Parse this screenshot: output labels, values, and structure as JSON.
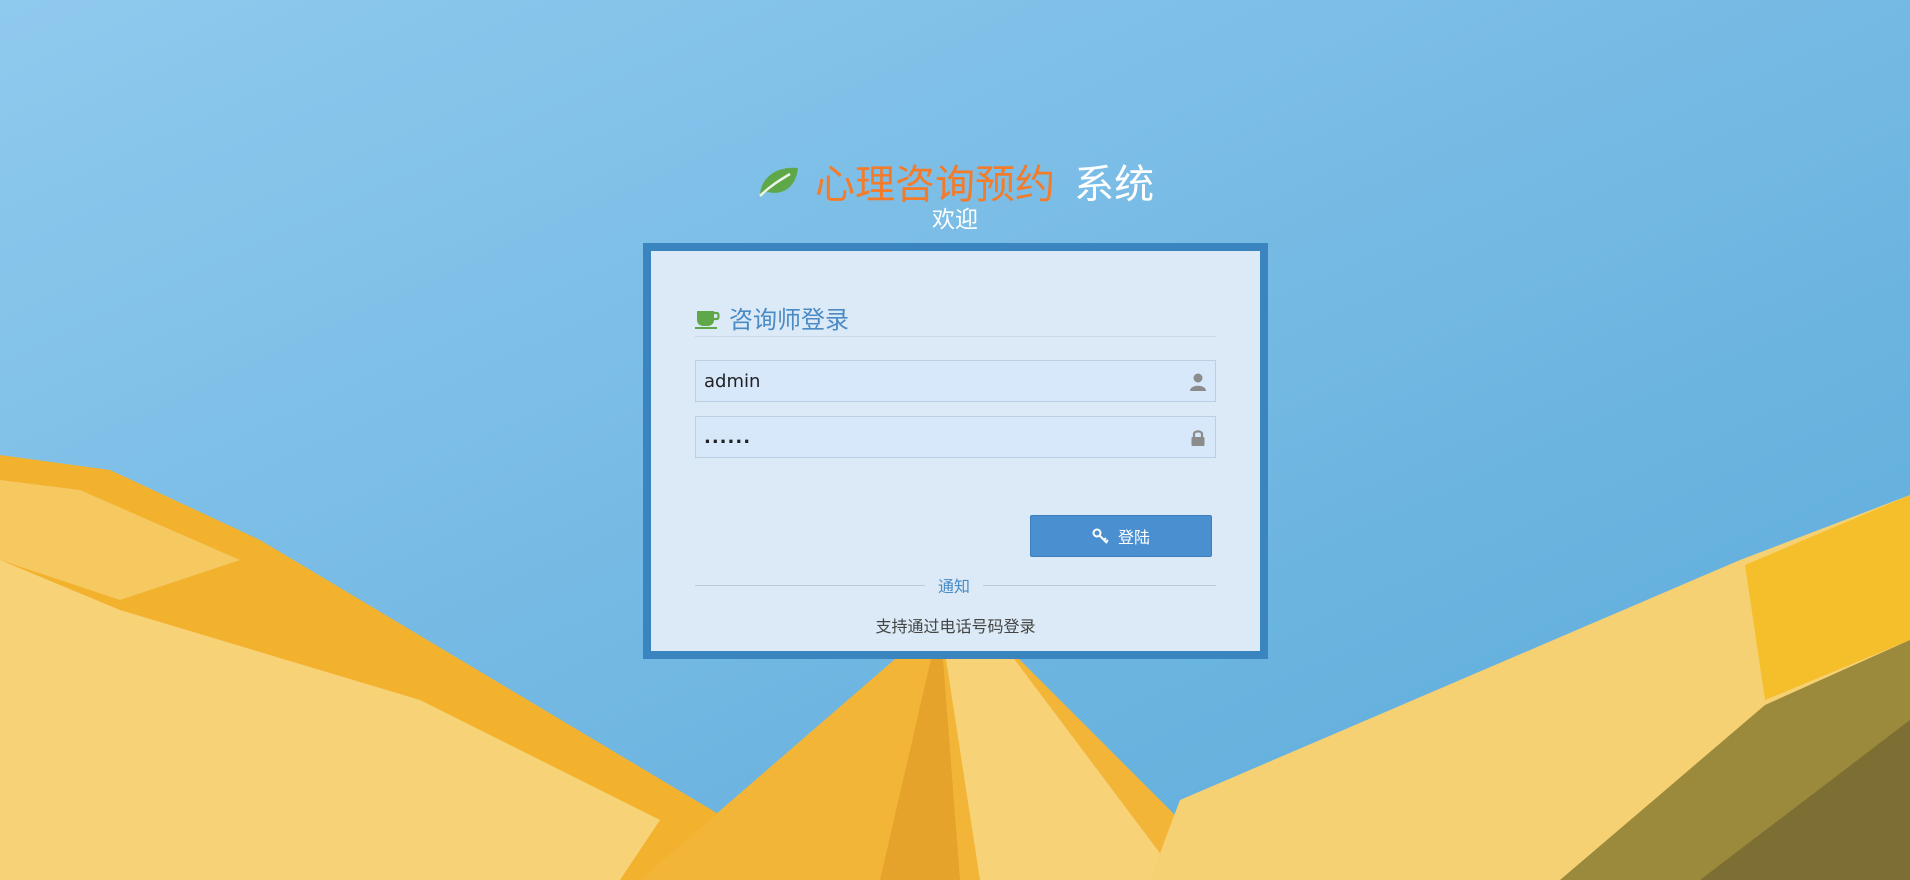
{
  "header": {
    "title_main": "心理咨询预约",
    "title_suffix": "系统",
    "welcome": "欢迎"
  },
  "login": {
    "title": "咨询师登录",
    "username_value": "admin",
    "password_value": "......",
    "button_label": "登陆"
  },
  "notice": {
    "title": "通知",
    "text": "支持通过电话号码登录"
  },
  "icons": {
    "brand": "leaf-icon",
    "panel": "coffee-cup-icon",
    "username": "user-icon",
    "password": "lock-icon",
    "button": "key-icon"
  },
  "colors": {
    "sky": "#7dbbe6",
    "brand_orange": "#f47b2a",
    "leaf_green": "#5ea84a",
    "frame_blue": "#3a85bf",
    "button_blue": "#4a90d0",
    "paper_yellow": "#f7d277",
    "paper_orange": "#f2b22e"
  }
}
